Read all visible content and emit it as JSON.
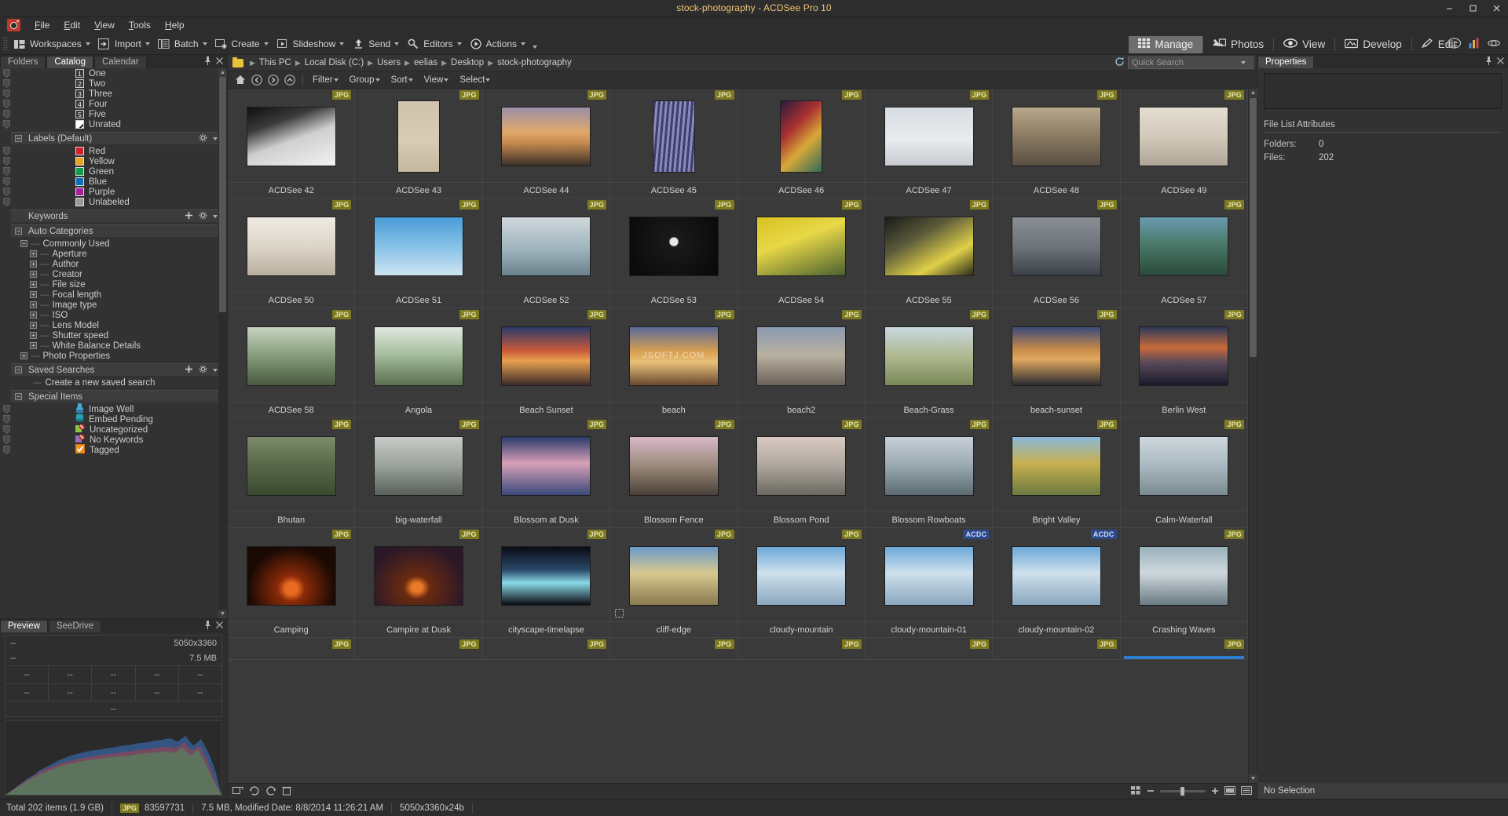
{
  "window": {
    "title": "stock-photography - ACDSee Pro 10",
    "min_label": "—",
    "max_label": "▢",
    "close_label": "✕"
  },
  "menubar": {
    "logo_name": "acdsee-logo",
    "items": [
      "File",
      "Edit",
      "View",
      "Tools",
      "Help"
    ]
  },
  "toolbar": {
    "groups": [
      {
        "label": "Workspaces",
        "icon": "workspaces-icon"
      },
      {
        "label": "Import",
        "icon": "import-icon"
      },
      {
        "label": "Batch",
        "icon": "batch-icon"
      },
      {
        "label": "Create",
        "icon": "create-icon"
      },
      {
        "label": "Slideshow",
        "icon": "slideshow-icon"
      },
      {
        "label": "Send",
        "icon": "send-icon"
      },
      {
        "label": "Editors",
        "icon": "editors-icon"
      },
      {
        "label": "Actions",
        "icon": "actions-icon"
      }
    ],
    "modes": [
      {
        "label": "Manage",
        "icon": "grid-icon",
        "active": true
      },
      {
        "label": "Photos",
        "icon": "photos-icon",
        "active": false
      },
      {
        "label": "View",
        "icon": "eye-icon",
        "active": false
      },
      {
        "label": "Develop",
        "icon": "develop-icon",
        "active": false
      },
      {
        "label": "Edit",
        "icon": "edit-icon",
        "active": false
      }
    ],
    "right_icons": [
      "face-icon",
      "chart-icon",
      "360-icon"
    ]
  },
  "left_panel": {
    "tabs": [
      {
        "label": "Folders",
        "active": false
      },
      {
        "label": "Catalog",
        "active": true
      },
      {
        "label": "Calendar",
        "active": false
      }
    ],
    "pin_label": "⚲",
    "close_label": "✕",
    "ratings": [
      {
        "num": "1",
        "label": "One"
      },
      {
        "num": "2",
        "label": "Two"
      },
      {
        "num": "3",
        "label": "Three"
      },
      {
        "num": "4",
        "label": "Four"
      },
      {
        "num": "5",
        "label": "Five"
      }
    ],
    "unrated_label": "Unrated",
    "labels_header": "Labels (Default)",
    "labels": [
      {
        "label": "Red",
        "color": "#cc2229"
      },
      {
        "label": "Yellow",
        "color": "#e8a324"
      },
      {
        "label": "Green",
        "color": "#0f9d46"
      },
      {
        "label": "Blue",
        "color": "#0b6fb5"
      },
      {
        "label": "Purple",
        "color": "#a4219b"
      },
      {
        "label": "Unlabeled",
        "color": "#9a9a9a"
      }
    ],
    "keywords_header": "Keywords",
    "auto_categories_header": "Auto Categories",
    "commonly_used": "Commonly Used",
    "commonly_used_items": [
      "Aperture",
      "Author",
      "Creator",
      "File size",
      "Focal length",
      "Image type",
      "ISO",
      "Lens Model",
      "Shutter speed",
      "White Balance Details"
    ],
    "photo_properties": "Photo Properties",
    "saved_searches_header": "Saved Searches",
    "create_saved_search": "Create a new saved search",
    "special_items_header": "Special Items",
    "special_items": [
      {
        "label": "Image Well",
        "color": "#4aa8d8"
      },
      {
        "label": "Embed Pending",
        "color": "#2aa0b5"
      },
      {
        "label": "Uncategorized",
        "color": "#8cc63e"
      },
      {
        "label": "No Keywords",
        "color": "#9b6bbf"
      },
      {
        "label": "Tagged",
        "color": "#f0901e"
      }
    ]
  },
  "preview_panel": {
    "tabs": [
      {
        "label": "Preview",
        "active": true
      },
      {
        "label": "SeeDrive",
        "active": false
      }
    ],
    "pin_label": "⚲",
    "close_label": "✕",
    "line1_left": "--",
    "line1_right": "5050x3360",
    "line2_left": "--",
    "line2_right": "7.5 MB",
    "grid_row1": [
      "--",
      "--",
      "--",
      "--",
      "--"
    ],
    "grid_row2": [
      "--",
      "--",
      "--",
      "--",
      "--"
    ],
    "grid_single": "--"
  },
  "breadcrumb": {
    "folder_icon": "folder-icon",
    "parts": [
      "This PC",
      "Local Disk (C:)",
      "Users",
      "eelias",
      "Desktop",
      "stock-photography"
    ],
    "refresh_icon": "refresh-icon",
    "search_placeholder": "Quick Search"
  },
  "filterbar": {
    "nav_icons": [
      "home-icon",
      "back-icon",
      "forward-icon",
      "up-icon"
    ],
    "menus": [
      "Filter",
      "Group",
      "Sort",
      "View",
      "Select"
    ]
  },
  "grid_status": {
    "left_icons": [
      "rotate-left-icon",
      "rotate-ccw-icon",
      "rotate-cw-icon",
      "delete-icon"
    ],
    "right_icons": [
      "thumb-small-icon",
      "thumb-large-icon",
      "minus-icon",
      "plus-icon",
      "filmstrip-icon",
      "details-icon"
    ]
  },
  "right_panel": {
    "tab_label": "Properties",
    "pin_label": "⚲",
    "close_label": "✕",
    "section_title": "File List Attributes",
    "rows": [
      {
        "key": "Folders:",
        "value": "0"
      },
      {
        "key": "Files:",
        "value": "202"
      }
    ],
    "footer": "No Selection"
  },
  "statusbar": {
    "total": "Total 202 items  (1.9 GB)",
    "format_badge": "JPG",
    "file_id": "83597731",
    "file_info": "7.5 MB, Modified Date: 8/8/2014 11:26:21 AM",
    "dimensions": "5050x3360x24b"
  },
  "thumbnails": [
    {
      "name": "ACDSee 42",
      "badge": "JPG",
      "thumb": "t-arch-gray",
      "ratio": "wide"
    },
    {
      "name": "ACDSee 43",
      "badge": "JPG",
      "thumb": "t-beach-person",
      "ratio": "tall"
    },
    {
      "name": "ACDSee 44",
      "badge": "JPG",
      "thumb": "t-mountain-sunset",
      "ratio": "wide"
    },
    {
      "name": "ACDSee 45",
      "badge": "JPG",
      "thumb": "t-building-grid",
      "ratio": "tall"
    },
    {
      "name": "ACDSee 46",
      "badge": "JPG",
      "thumb": "t-graffiti",
      "ratio": "tall"
    },
    {
      "name": "ACDSee 47",
      "badge": "JPG",
      "thumb": "t-snow-cabin",
      "ratio": "wide"
    },
    {
      "name": "ACDSee 48",
      "badge": "JPG",
      "thumb": "t-street-car",
      "ratio": "wide"
    },
    {
      "name": "ACDSee 49",
      "badge": "JPG",
      "thumb": "t-tiled-room",
      "ratio": "wide"
    },
    {
      "name": "ACDSee 50",
      "badge": "JPG",
      "thumb": "t-corridor",
      "ratio": "wide"
    },
    {
      "name": "ACDSee 51",
      "badge": "JPG",
      "thumb": "t-bird-sky",
      "ratio": "wide"
    },
    {
      "name": "ACDSee 52",
      "badge": "JPG",
      "thumb": "t-island-sea",
      "ratio": "wide"
    },
    {
      "name": "ACDSee 53",
      "badge": "JPG",
      "thumb": "t-moon-black",
      "ratio": "wide"
    },
    {
      "name": "ACDSee 54",
      "badge": "JPG",
      "thumb": "t-yellow-tulips",
      "ratio": "wide"
    },
    {
      "name": "ACDSee 55",
      "badge": "JPG",
      "thumb": "t-single-tulip",
      "ratio": "wide"
    },
    {
      "name": "ACDSee 56",
      "badge": "JPG",
      "thumb": "t-sailboat-bw",
      "ratio": "wide"
    },
    {
      "name": "ACDSee 57",
      "badge": "JPG",
      "thumb": "t-coast-cliff",
      "ratio": "wide"
    },
    {
      "name": "ACDSee 58",
      "badge": "JPG",
      "thumb": "t-forest-road",
      "ratio": "wide"
    },
    {
      "name": "Angola",
      "badge": "JPG",
      "thumb": "t-waterfall-green",
      "ratio": "wide"
    },
    {
      "name": "Beach Sunset",
      "badge": "JPG",
      "thumb": "t-beach-sunset",
      "ratio": "wide"
    },
    {
      "name": "beach",
      "badge": "JPG",
      "thumb": "t-beach-golden",
      "ratio": "wide",
      "watermark": "JSOFTJ.COM"
    },
    {
      "name": "beach2",
      "badge": "JPG",
      "thumb": "t-beach-walk",
      "ratio": "wide"
    },
    {
      "name": "Beach-Grass",
      "badge": "JPG",
      "thumb": "t-beach-grass",
      "ratio": "wide"
    },
    {
      "name": "beach-sunset",
      "badge": "JPG",
      "thumb": "t-pier-sunset",
      "ratio": "wide"
    },
    {
      "name": "Berlin West",
      "badge": "JPG",
      "thumb": "t-berlin-night",
      "ratio": "wide"
    },
    {
      "name": "Bhutan",
      "badge": "JPG",
      "thumb": "t-bhutan-cliff",
      "ratio": "wide"
    },
    {
      "name": "big-waterfall",
      "badge": "JPG",
      "thumb": "t-big-waterfall",
      "ratio": "wide"
    },
    {
      "name": "Blossom at Dusk",
      "badge": "JPG",
      "thumb": "t-blossom-dusk",
      "ratio": "wide"
    },
    {
      "name": "Blossom Fence",
      "badge": "JPG",
      "thumb": "t-blossom-fence",
      "ratio": "wide"
    },
    {
      "name": "Blossom Pond",
      "badge": "JPG",
      "thumb": "t-blossom-pond",
      "ratio": "wide"
    },
    {
      "name": "Blossom Rowboats",
      "badge": "JPG",
      "thumb": "t-blossom-rowboats",
      "ratio": "wide"
    },
    {
      "name": "Bright Valley",
      "badge": "JPG",
      "thumb": "t-bright-valley",
      "ratio": "wide"
    },
    {
      "name": "Calm-Waterfall",
      "badge": "JPG",
      "thumb": "t-calm-waterfall",
      "ratio": "wide"
    },
    {
      "name": "Camping",
      "badge": "JPG",
      "thumb": "t-campfire",
      "ratio": "wide"
    },
    {
      "name": "Campire at Dusk",
      "badge": "JPG",
      "thumb": "t-campfire-dusk",
      "ratio": "wide"
    },
    {
      "name": "cityscape-timelapse",
      "badge": "JPG",
      "thumb": "t-city-timelapse",
      "ratio": "wide"
    },
    {
      "name": "cliff-edge",
      "badge": "JPG",
      "thumb": "t-cliff-edge",
      "ratio": "wide",
      "rotate_icon": true
    },
    {
      "name": "cloudy-mountain",
      "badge": "JPG",
      "thumb": "t-cloudy-mountain",
      "ratio": "wide"
    },
    {
      "name": "cloudy-mountain-01",
      "badge": "ACDC",
      "thumb": "t-cloudy-mountain",
      "ratio": "wide"
    },
    {
      "name": "cloudy-mountain-02",
      "badge": "ACDC",
      "thumb": "t-cloudy-mountain",
      "ratio": "wide"
    },
    {
      "name": "Crashing Waves",
      "badge": "JPG",
      "thumb": "t-crashing-waves",
      "ratio": "wide"
    }
  ],
  "partial_row_badges": [
    "JPG",
    "JPG",
    "JPG",
    "JPG",
    "JPG",
    "JPG",
    "JPG",
    "JPG"
  ]
}
